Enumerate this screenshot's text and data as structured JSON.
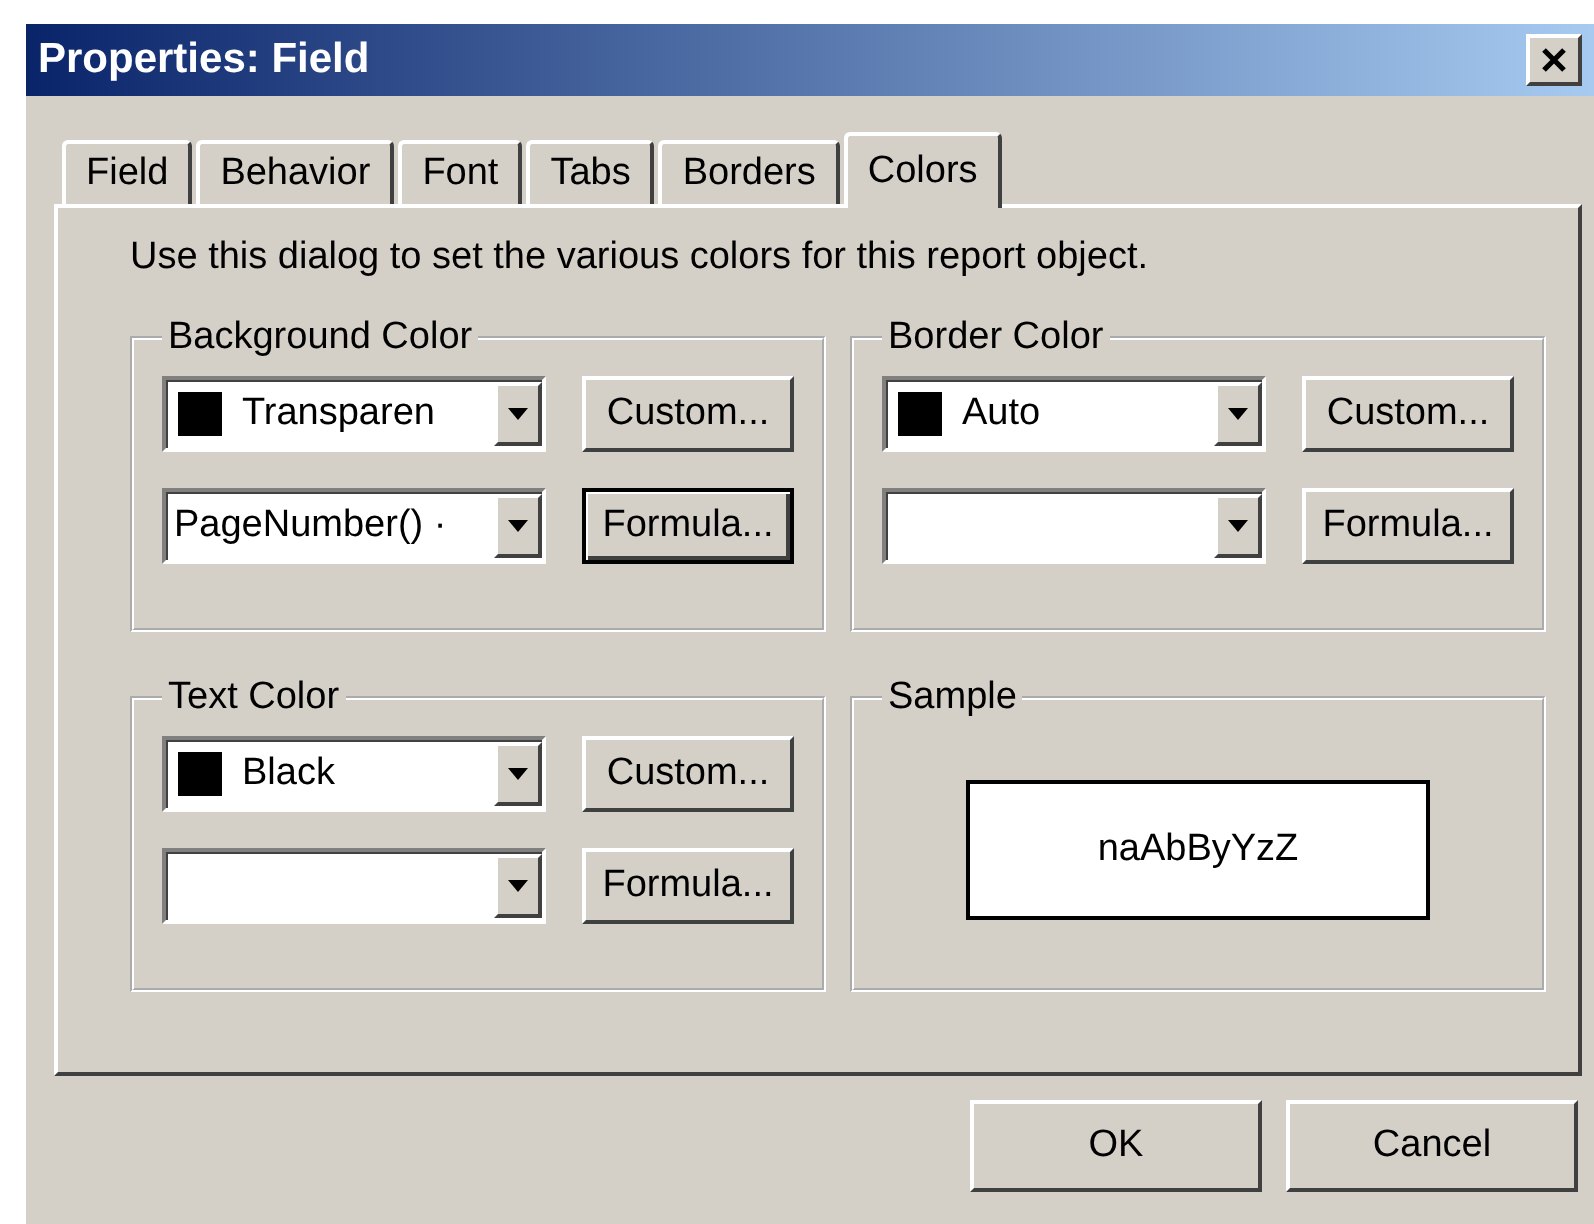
{
  "window": {
    "title": "Properties: Field"
  },
  "tabs": [
    {
      "label": "Field",
      "selected": false
    },
    {
      "label": "Behavior",
      "selected": false
    },
    {
      "label": "Font",
      "selected": false
    },
    {
      "label": "Tabs",
      "selected": false
    },
    {
      "label": "Borders",
      "selected": false
    },
    {
      "label": "Colors",
      "selected": true
    }
  ],
  "description": "Use this dialog to set the various colors for this report object.",
  "groups": [
    {
      "kind": "colors",
      "title": "Background Color",
      "color_select": {
        "value": "Transparen",
        "color": "#000000"
      },
      "formula_select": {
        "value": "PageNumber() ·"
      },
      "custom_button": {
        "label": "Custom...",
        "focused": false
      },
      "formula_button": {
        "label": "Formula...",
        "focused": true
      }
    },
    {
      "kind": "colors",
      "title": "Border Color",
      "color_select": {
        "value": "Auto",
        "color": "#000000"
      },
      "custom_button": {
        "label": "Custom...",
        "focused": false
      },
      "formula_button": {
        "label": "Formula...",
        "focused": false
      }
    },
    {
      "kind": "colors",
      "title": "Text Color",
      "color_select": {
        "value": "Black",
        "color": "#000000"
      },
      "custom_button": {
        "label": "Custom...",
        "focused": false
      },
      "formula_button": {
        "label": "Formula...",
        "focused": false
      }
    },
    {
      "kind": "sample",
      "title": "Sample",
      "sample_text": "naAbByYzZ"
    }
  ],
  "buttons": [
    {
      "label": "OK"
    },
    {
      "label": "Cancel"
    }
  ]
}
